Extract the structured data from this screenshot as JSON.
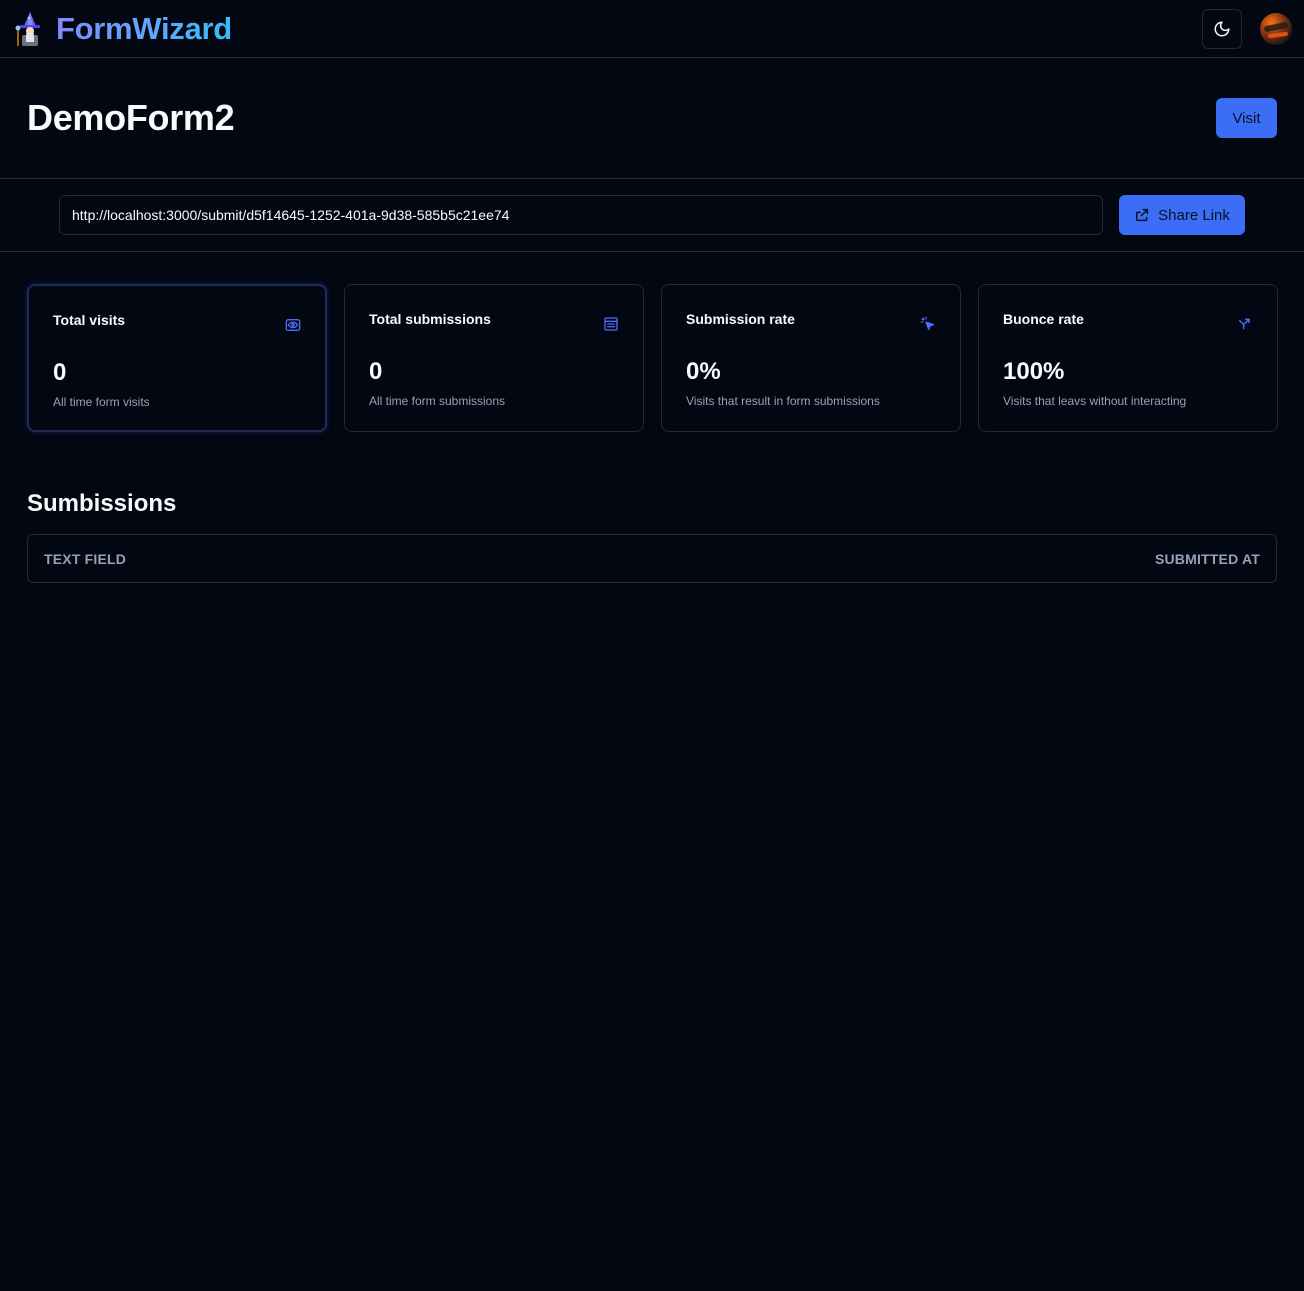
{
  "navbar": {
    "brand": "FormWizard",
    "logo_icon": "wizard-icon",
    "theme_icon": "moon-icon"
  },
  "header": {
    "title": "DemoForm2",
    "visit_label": "Visit"
  },
  "share": {
    "url": "http://localhost:3000/submit/d5f14645-1252-401a-9d38-585b5c21ee74",
    "button_label": "Share Link",
    "button_icon": "share-icon"
  },
  "stats": [
    {
      "title": "Total visits",
      "value": "0",
      "desc": "All time form visits",
      "icon": "eye-icon"
    },
    {
      "title": "Total submissions",
      "value": "0",
      "desc": "All time form submissions",
      "icon": "form-icon"
    },
    {
      "title": "Submission rate",
      "value": "0%",
      "desc": "Visits that result in form submissions",
      "icon": "cursor-click-icon"
    },
    {
      "title": "Buonce rate",
      "value": "100%",
      "desc": "Visits that leavs without interacting",
      "icon": "split-arrow-icon"
    }
  ],
  "submissions": {
    "title": "Sumbissions",
    "columns": [
      "TEXT FIELD",
      "SUBMITTED AT"
    ]
  },
  "colors": {
    "background": "#030712",
    "accent": "#3b6df6",
    "border": "#1f2937",
    "muted_text": "#94a3b8"
  }
}
